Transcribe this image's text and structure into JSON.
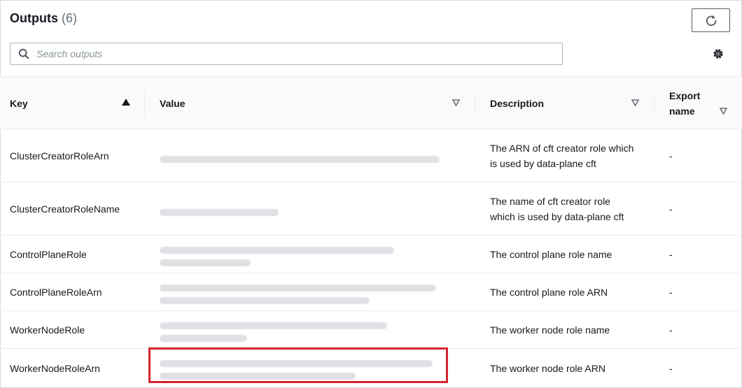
{
  "header": {
    "title": "Outputs",
    "count": "(6)"
  },
  "search": {
    "placeholder": "Search outputs"
  },
  "columns": {
    "key": "Key",
    "value": "Value",
    "description": "Description",
    "export_line1": "Export",
    "export_line2": "name"
  },
  "rows": [
    {
      "key": "ClusterCreatorRoleArn",
      "description": "The ARN of cft creator role which is used by data-plane cft",
      "export": "-"
    },
    {
      "key": "ClusterCreatorRoleName",
      "description": "The name of cft creator role which is used by data-plane cft",
      "export": "-"
    },
    {
      "key": "ControlPlaneRole",
      "description": "The control plane role name",
      "export": "-"
    },
    {
      "key": "ControlPlaneRoleArn",
      "description": "The control plane role ARN",
      "export": "-"
    },
    {
      "key": "WorkerNodeRole",
      "description": "The worker node role name",
      "export": "-"
    },
    {
      "key": "WorkerNodeRoleArn",
      "description": "The worker node role ARN",
      "export": "-"
    }
  ],
  "icons": {
    "refresh": "refresh-icon",
    "search": "search-icon",
    "settings": "gear-icon"
  },
  "colors": {
    "highlight": "#d5232f",
    "border": "#eaeded"
  }
}
